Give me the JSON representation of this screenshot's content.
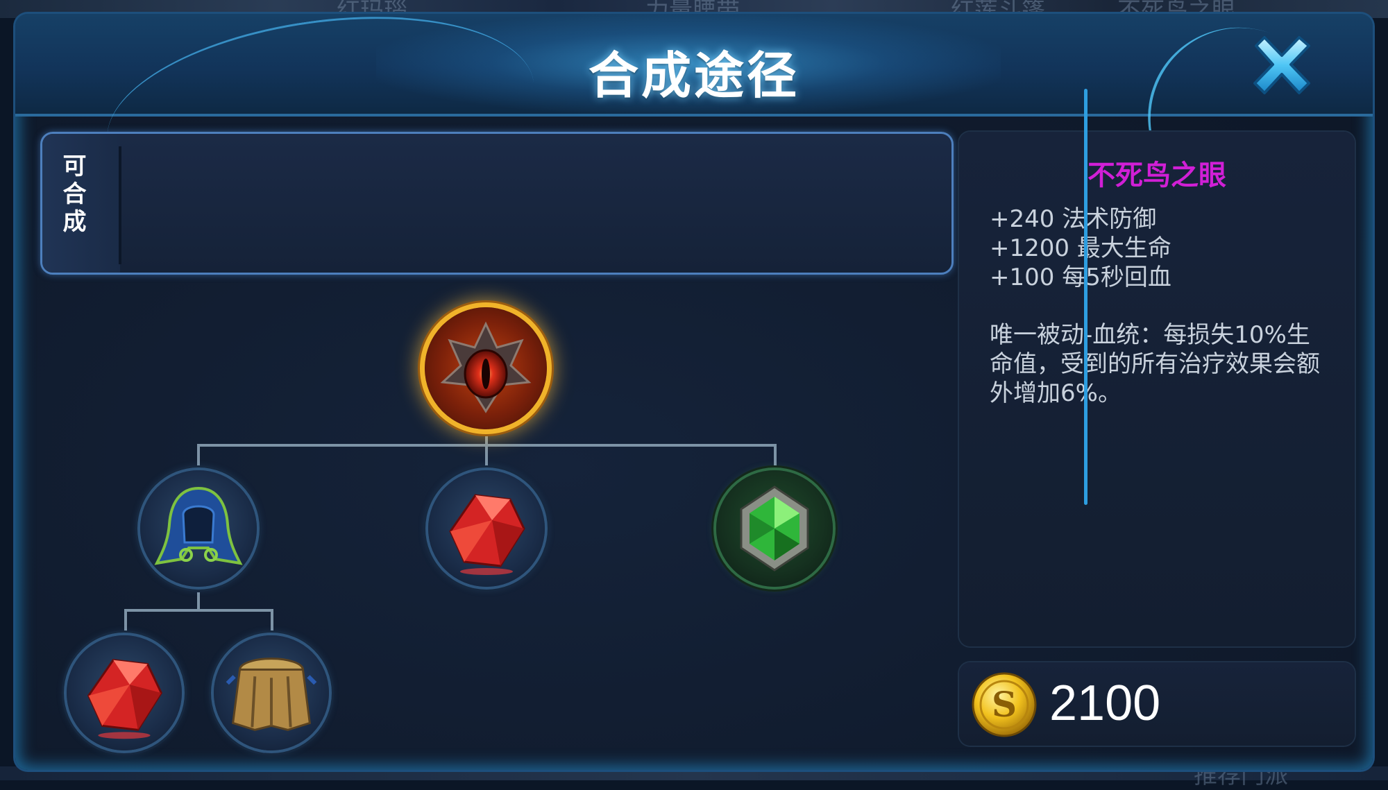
{
  "background": {
    "top_labels": [
      "红玛瑙",
      "力量腰带",
      "红莲斗篷",
      "不死鸟之眼"
    ],
    "bottom_label": "推荐门派"
  },
  "dialog": {
    "title": "合成途径",
    "close_icon": "close-x-icon",
    "accent_color": "#2ea0e0"
  },
  "craftable": {
    "label": "可合成",
    "items": []
  },
  "recipe_tree": {
    "root": {
      "name": "不死鸟之眼",
      "icon": "phoenix-eye-icon"
    },
    "children": [
      {
        "name": "红莲斗篷",
        "icon": "hooded-cloak-icon",
        "children": [
          {
            "name": "红玛瑙",
            "icon": "red-crystal-icon"
          },
          {
            "name": "力量腰带",
            "icon": "leather-belt-icon"
          }
        ]
      },
      {
        "name": "红玛瑙",
        "icon": "red-crystal-icon"
      },
      {
        "name": "翡翠",
        "icon": "green-gem-icon"
      }
    ]
  },
  "item_info": {
    "name": "不死鸟之眼",
    "name_color": "#d11fd6",
    "stats": [
      "+240 法术防御",
      "+1200 最大生命",
      "+100 每5秒回血"
    ],
    "passive": "唯一被动-血统：每损失10%生命值，受到的所有治疗效果会额外增加6%。"
  },
  "price": {
    "value": "2100",
    "icon": "gold-coin-icon"
  }
}
